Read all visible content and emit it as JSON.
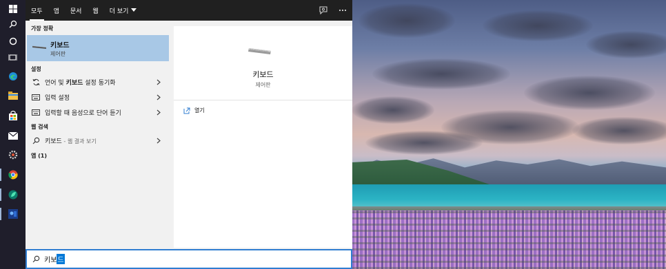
{
  "tabs": [
    {
      "label": "모두"
    },
    {
      "label": "앱"
    },
    {
      "label": "문서"
    },
    {
      "label": "웹"
    },
    {
      "label": "더 보기"
    }
  ],
  "sections": {
    "best_match_header": "가장 정확",
    "settings_header": "설정",
    "web_header": "웹 검색",
    "apps_header": "앱 (1)"
  },
  "best_match": {
    "title": "키보드",
    "subtitle": "제어판"
  },
  "settings_items": [
    {
      "prefix": "언어 및 ",
      "bold": "키보드",
      "suffix": " 설정 동기화"
    },
    {
      "prefix": "입력 설정",
      "bold": "",
      "suffix": ""
    },
    {
      "prefix": "입력할 때 음성으로 단어 듣기",
      "bold": "",
      "suffix": ""
    }
  ],
  "web_item": {
    "label": "키보드",
    "detail": " - 웹 결과 보기"
  },
  "preview": {
    "title": "키보드",
    "subtitle": "제어판",
    "open_label": "열기"
  },
  "search": {
    "typed": "키보",
    "selected": "드"
  },
  "colors": {
    "accent": "#0078d7",
    "selected_row": "#a8c8e6",
    "topbar": "#202020"
  }
}
